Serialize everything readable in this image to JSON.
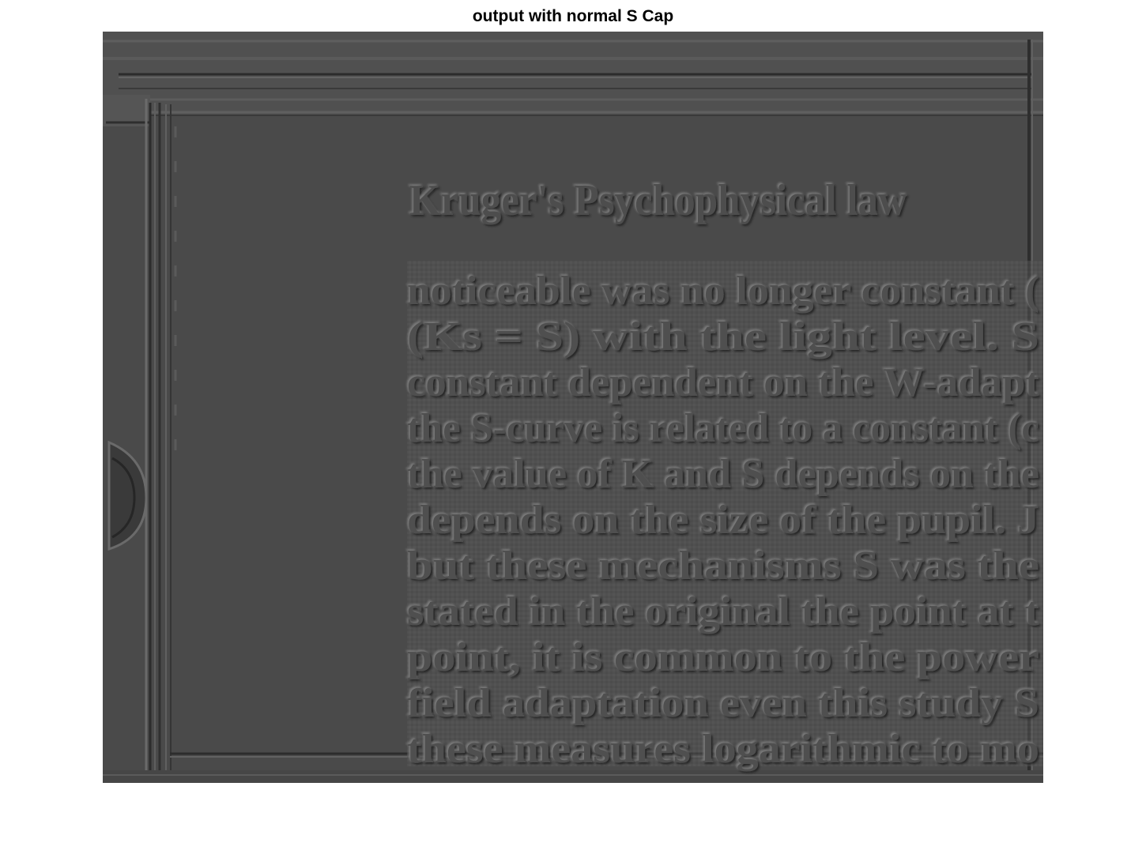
{
  "figure": {
    "title": "output with normal S Cap"
  },
  "image": {
    "kind": "filtered-grayscale-image",
    "background_color": "#4a4a4a",
    "highlight_color": "#6a6a6a",
    "shadow_color": "#2a2a2a",
    "heading": "Kruger's Psychophysical law",
    "body_lines": [
      "noticeable was no longer constant (",
      "(Ks = S) with the light level. S",
      "constant dependent on the W-adapt",
      "the S-curve is related to a constant (c",
      "the value of K and S depends on the",
      "depends on the size of the pupil. J",
      "but these mechanisms S was the",
      "stated in the original the point at t",
      "point, it is common to the power",
      "field adaptation even this study S",
      "these measures logarithmic to mo"
    ]
  }
}
